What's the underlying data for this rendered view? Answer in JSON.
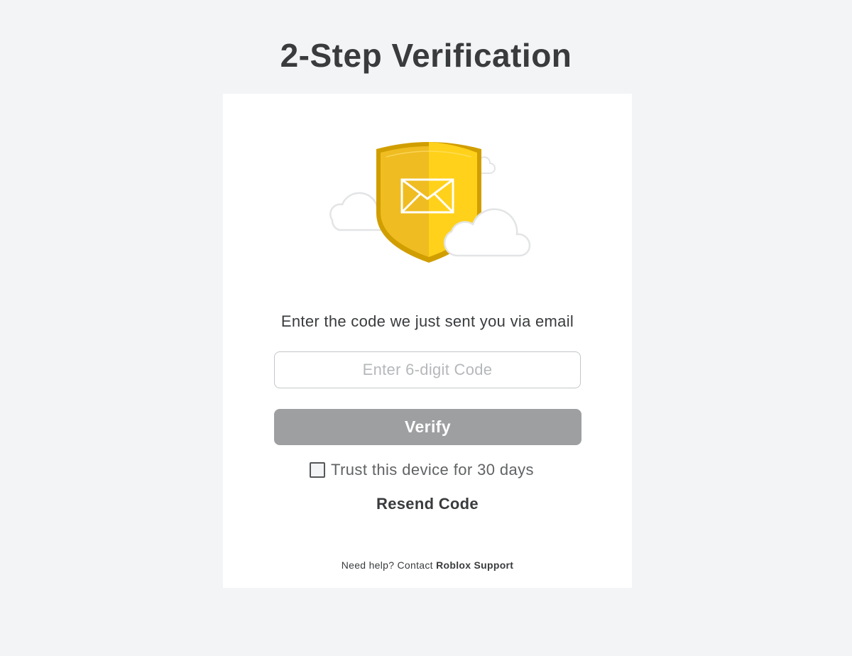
{
  "page": {
    "title": "2-Step Verification"
  },
  "card": {
    "instruction": "Enter the code we just sent you via email",
    "code_input": {
      "value": "",
      "placeholder": "Enter 6-digit Code"
    },
    "verify_label": "Verify",
    "trust_device": {
      "label": "Trust this device for 30 days",
      "checked": false
    },
    "resend_label": "Resend Code",
    "help": {
      "prefix": "Need help? Contact",
      "link_label": "Roblox Support"
    }
  },
  "colors": {
    "background": "#f2f4f5",
    "card": "#ffffff",
    "verify_button_disabled": "#9d9fa1",
    "shield_gold": "#ffd11a",
    "shield_dark": "#d19e00"
  },
  "icons": {
    "illustration": "shield-email-icon",
    "decor": "cloud-icon"
  }
}
